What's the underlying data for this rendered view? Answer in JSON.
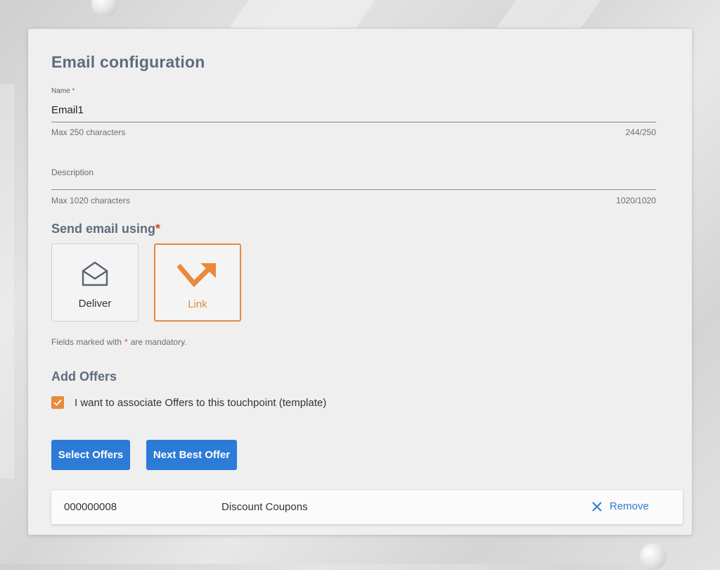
{
  "form": {
    "title": "Email configuration",
    "name": {
      "label": "Name",
      "required_mark": "*",
      "value": "Email1",
      "hint": "Max 250 characters",
      "counter": "244/250"
    },
    "description": {
      "label": "Description",
      "value": "",
      "hint": "Max 1020 characters",
      "counter": "1020/1020"
    },
    "send_using": {
      "title": "Send email using",
      "required_mark": "*",
      "options": [
        {
          "label": "Deliver",
          "icon": "envelope-open-icon",
          "selected": false
        },
        {
          "label": "Link",
          "icon": "arrow-link-icon",
          "selected": true
        }
      ]
    },
    "mandatory_note": {
      "prefix": "Fields marked with",
      "star": "*",
      "suffix": "are mandatory."
    }
  },
  "offers": {
    "title": "Add Offers",
    "checkbox": {
      "label": "I want to associate Offers to this touchpoint (template)",
      "checked": true
    },
    "buttons": {
      "select": "Select Offers",
      "next_best": "Next Best Offer"
    },
    "rows": [
      {
        "id": "000000008",
        "name": "Discount Coupons",
        "action": "Remove"
      }
    ]
  },
  "colors": {
    "accent_orange": "#e8893b",
    "primary_blue": "#2c7bd6",
    "title_slate": "#5f6b80",
    "required_red": "#d04a2f"
  }
}
